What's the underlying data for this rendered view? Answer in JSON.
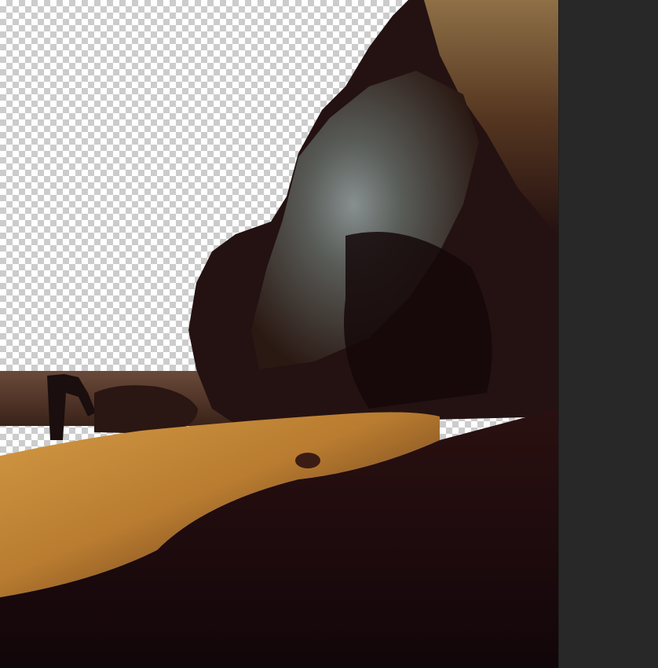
{
  "workspace": {
    "pasteboard_color": "#282828",
    "checker_light": "#ffffff",
    "checker_dark": "#cccccc"
  },
  "canvas": {
    "layer_content": "cave-rock-photo-cutout",
    "background": "transparency-checkerboard"
  },
  "palette": {
    "rock_dark": "#1a0b0b",
    "rock_brown": "#3a2418",
    "rock_lit_gray": "#7f8a8c",
    "sand_gold": "#c98f3a",
    "shadow": "#120608",
    "horizon": "#5a3d30"
  }
}
